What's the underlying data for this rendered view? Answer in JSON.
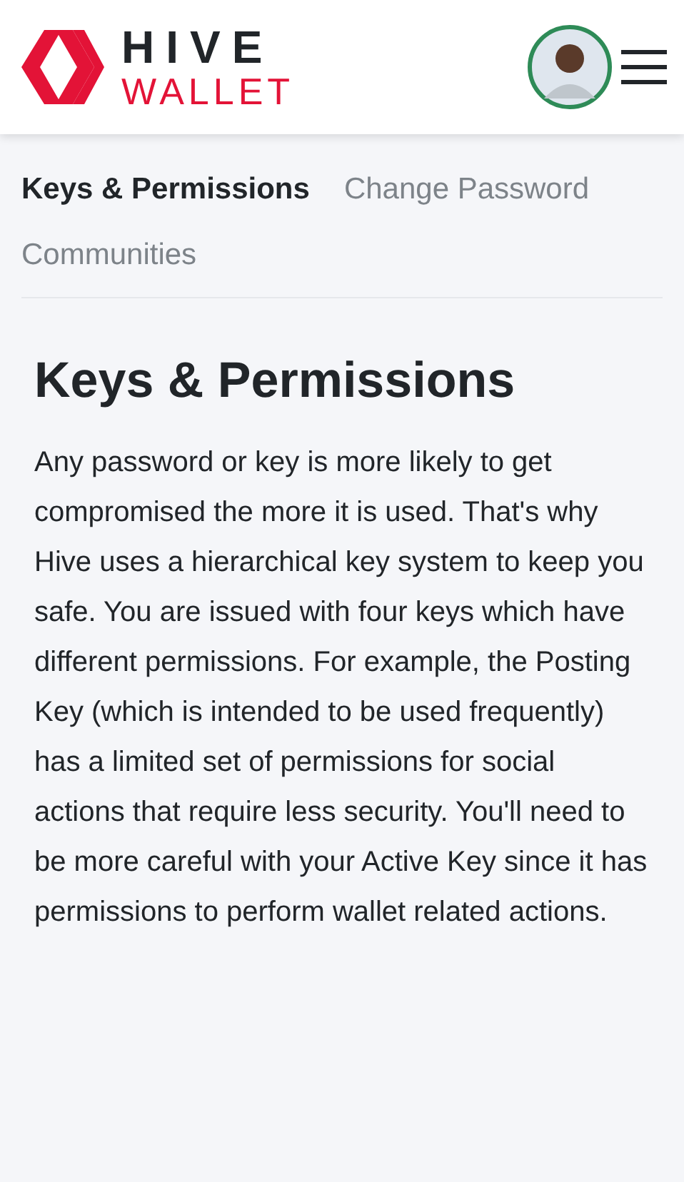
{
  "header": {
    "logo": {
      "line_1": "HIVE",
      "line_2": "WALLET"
    }
  },
  "tabs": [
    {
      "label": "Keys & Permissions",
      "selected": true
    },
    {
      "label": "Change Password",
      "selected": false
    },
    {
      "label": "Communities",
      "selected": false
    }
  ],
  "section": {
    "title": "Keys & Permissions",
    "body": "Any password or key is more likely to get compromised the more it is used. That's why Hive uses a hierarchical key system to keep you safe. You are issued with four keys which have different permissions. For example, the Posting Key (which is intended to be used frequently) has a limited set of permissions for social actions that require less security. You'll need to be more careful with your Active Key since it has permissions to perform wallet related actions."
  }
}
